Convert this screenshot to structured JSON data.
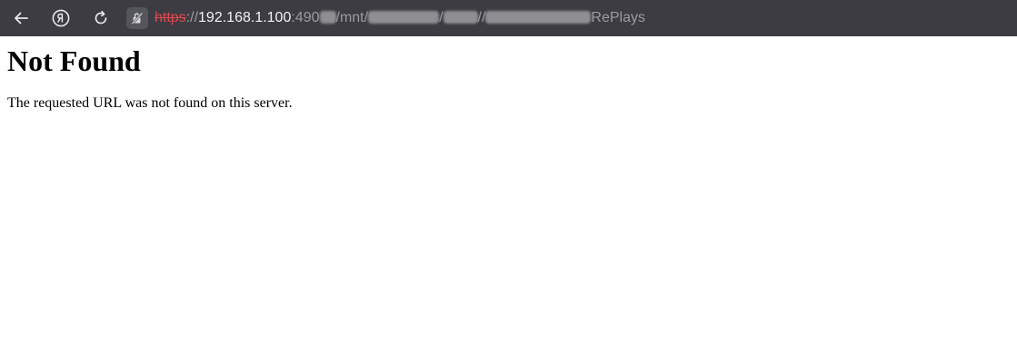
{
  "browser": {
    "back_icon": "arrow-left-icon",
    "yandex_icon": "yandex-logo-icon",
    "reload_icon": "reload-icon",
    "site_info_icon": "insecure-lock-icon",
    "url": {
      "scheme": "https",
      "separator": "://",
      "host": "192.168.1.100",
      "port_prefix": ":490",
      "path_1": "/mnt/",
      "path_2": "/",
      "path_3": "//",
      "path_end": "RePlays"
    },
    "colors": {
      "toolbar_bg": "#3c3c42",
      "insecure_scheme": "#e0474f"
    }
  },
  "page": {
    "heading": "Not Found",
    "message": "The requested URL was not found on this server."
  }
}
